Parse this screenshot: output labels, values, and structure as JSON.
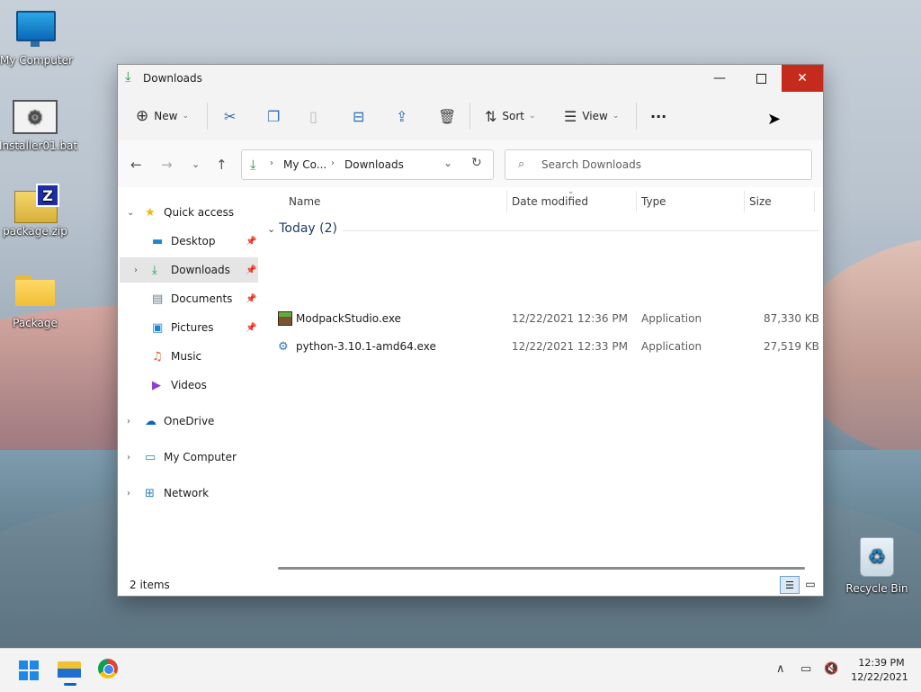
{
  "desktop": {
    "icons": [
      {
        "label": "My Computer"
      },
      {
        "label": "Installer01.bat"
      },
      {
        "label": "package.zip"
      },
      {
        "label": "Package"
      },
      {
        "label": "Recycle Bin"
      }
    ]
  },
  "window": {
    "title": "Downloads",
    "controls": {
      "minimize": "—",
      "close": "✕"
    }
  },
  "commandbar": {
    "new_label": "New",
    "sort_label": "Sort",
    "view_label": "View",
    "more_label": "···"
  },
  "navigation": {
    "back": "←",
    "forward": "→",
    "recent": "⌄",
    "up": "↑",
    "breadcrumb": [
      "My Co...",
      "Downloads"
    ],
    "search_placeholder": "Search Downloads"
  },
  "navpane": {
    "quick_access": "Quick access",
    "items": [
      {
        "label": "Desktop"
      },
      {
        "label": "Downloads"
      },
      {
        "label": "Documents"
      },
      {
        "label": "Pictures"
      },
      {
        "label": "Music"
      },
      {
        "label": "Videos"
      }
    ],
    "onedrive": "OneDrive",
    "my_computer": "My Computer",
    "network": "Network"
  },
  "filelist": {
    "columns": {
      "name": "Name",
      "date": "Date modified",
      "type": "Type",
      "size": "Size"
    },
    "group_label": "Today (2)",
    "files": [
      {
        "name": "ModpackStudio.exe",
        "date": "12/22/2021 12:36 PM",
        "type": "Application",
        "size": "87,330 KB"
      },
      {
        "name": "python-3.10.1-amd64.exe",
        "date": "12/22/2021 12:33 PM",
        "type": "Application",
        "size": "27,519 KB"
      }
    ]
  },
  "status": {
    "item_count": "2 items"
  },
  "taskbar": {
    "time": "12:39 PM",
    "date": "12/22/2021"
  },
  "colors": {
    "accent": "#0067c0",
    "close_hover": "#c42b1c",
    "download_green": "#1a9c4b"
  }
}
